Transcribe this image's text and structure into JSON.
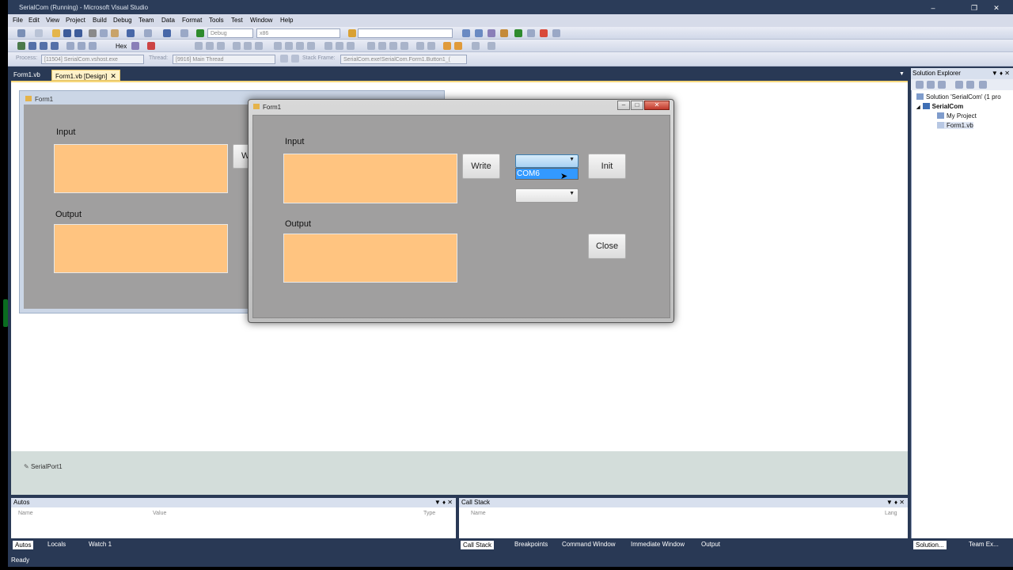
{
  "window": {
    "title": "SerialCom (Running) - Microsoft Visual Studio"
  },
  "menu": [
    "File",
    "Edit",
    "View",
    "Project",
    "Build",
    "Debug",
    "Team",
    "Data",
    "Format",
    "Tools",
    "Test",
    "Window",
    "Help"
  ],
  "toolbar": {
    "config": "Debug",
    "platform": "x86",
    "hex_label": "Hex",
    "process_label": "Process:",
    "process_value": "[11504] SerialCom.vshost.exe",
    "thread_label": "Thread:",
    "thread_value": "[9916] Main Thread",
    "stackframe_label": "Stack Frame:",
    "stackframe_value": "SerialCom.exe!SerialCom.Form1.Button1_("
  },
  "doc_tabs": [
    "Form1.vb",
    "Form1.vb [Design]"
  ],
  "design_form": {
    "title": "Form1",
    "input_label": "Input",
    "output_label": "Output",
    "write_partial": "W"
  },
  "run_form": {
    "title": "Form1",
    "input_label": "Input",
    "output_label": "Output",
    "write_button": "Write",
    "init_button": "Init",
    "close_button": "Close",
    "dropdown_option": "COM6"
  },
  "tray": {
    "component": "SerialPort1"
  },
  "solution_explorer": {
    "title": "Solution Explorer",
    "solution": "Solution 'SerialCom' (1 pro",
    "project": "SerialCom",
    "items": [
      "My Project",
      "Form1.vb"
    ]
  },
  "autos": {
    "title": "Autos",
    "columns": [
      "Name",
      "Value",
      "Type"
    ],
    "tabs": [
      "Autos",
      "Locals",
      "Watch 1"
    ]
  },
  "callstack": {
    "title": "Call Stack",
    "columns": [
      "Name",
      "Lang"
    ],
    "tabs": [
      "Call Stack",
      "Breakpoints",
      "Command Window",
      "Immediate Window",
      "Output"
    ]
  },
  "side_tabs": [
    "Solution...",
    "Team Ex..."
  ],
  "status": "Ready",
  "colors": {
    "vs_dark": "#293955",
    "textbox_orange": "#ffc480",
    "form_client": "#a09f9f",
    "selection_blue": "#3399ff"
  }
}
